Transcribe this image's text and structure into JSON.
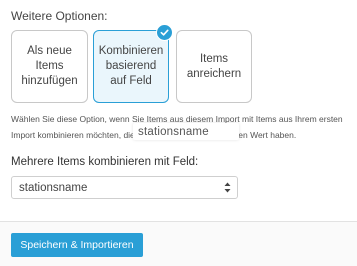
{
  "options_section": {
    "title": "Weitere Optionen:",
    "cards": [
      {
        "label": "Als neue Items hinzufügen",
        "selected": false
      },
      {
        "label": "Kombinieren basierend auf Feld",
        "selected": true
      },
      {
        "label": "Items anreichern",
        "selected": false
      }
    ],
    "help_text": "Wählen Sie diese Option, wenn Sie Items aus diesem Import mit Items aus Ihrem ersten Import kombinieren möchten, die im gewählten Feld denselben Wert haben.",
    "tooltip_value": "stationsname"
  },
  "merge_field": {
    "label": "Mehrere Items kombinieren mit Feld:",
    "selected_value": "stationsname"
  },
  "footer": {
    "save_button_label": "Speichern & Importieren"
  },
  "colors": {
    "accent": "#2a9fd6",
    "selected_card_bg": "#eaf6fc"
  }
}
